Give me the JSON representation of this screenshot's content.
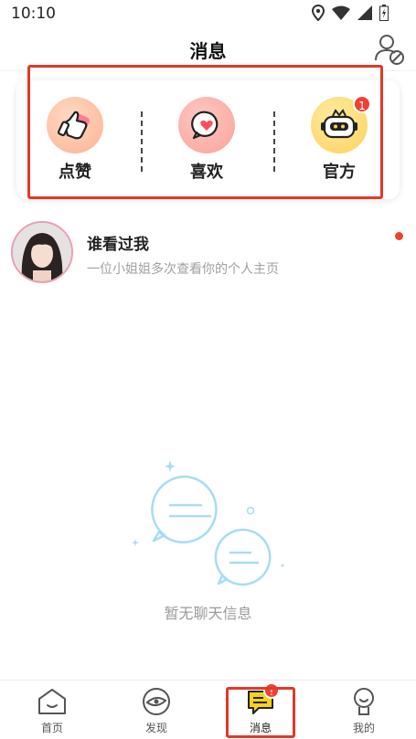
{
  "status_bar": {
    "time": "10:10",
    "icons": [
      "location-icon",
      "wifi-icon",
      "signal-icon",
      "battery-icon"
    ]
  },
  "header": {
    "title": "消息",
    "right_icon": "user-block-icon"
  },
  "quick_actions": [
    {
      "label": "点赞",
      "icon": "thumbs-up-icon",
      "badge": ""
    },
    {
      "label": "喜欢",
      "icon": "heart-chat-icon",
      "badge": ""
    },
    {
      "label": "官方",
      "icon": "robot-icon",
      "badge": "1"
    }
  ],
  "visitor": {
    "title": "谁看过我",
    "description": "一位小姐姐多次查看你的个人主页",
    "unread": true
  },
  "empty_state": {
    "text": "暂无聊天信息"
  },
  "bottom_nav": [
    {
      "label": "首页",
      "icon": "home-icon",
      "badge": ""
    },
    {
      "label": "发现",
      "icon": "eye-icon",
      "badge": ""
    },
    {
      "label": "消息",
      "icon": "message-icon",
      "badge": "!",
      "active": true
    },
    {
      "label": "我的",
      "icon": "profile-icon",
      "badge": ""
    }
  ],
  "colors": {
    "accent_red": "#e03a28",
    "badge_red": "#f04034",
    "message_yellow": "#f7d21a",
    "bubble_blue": "#a9dcf3"
  }
}
